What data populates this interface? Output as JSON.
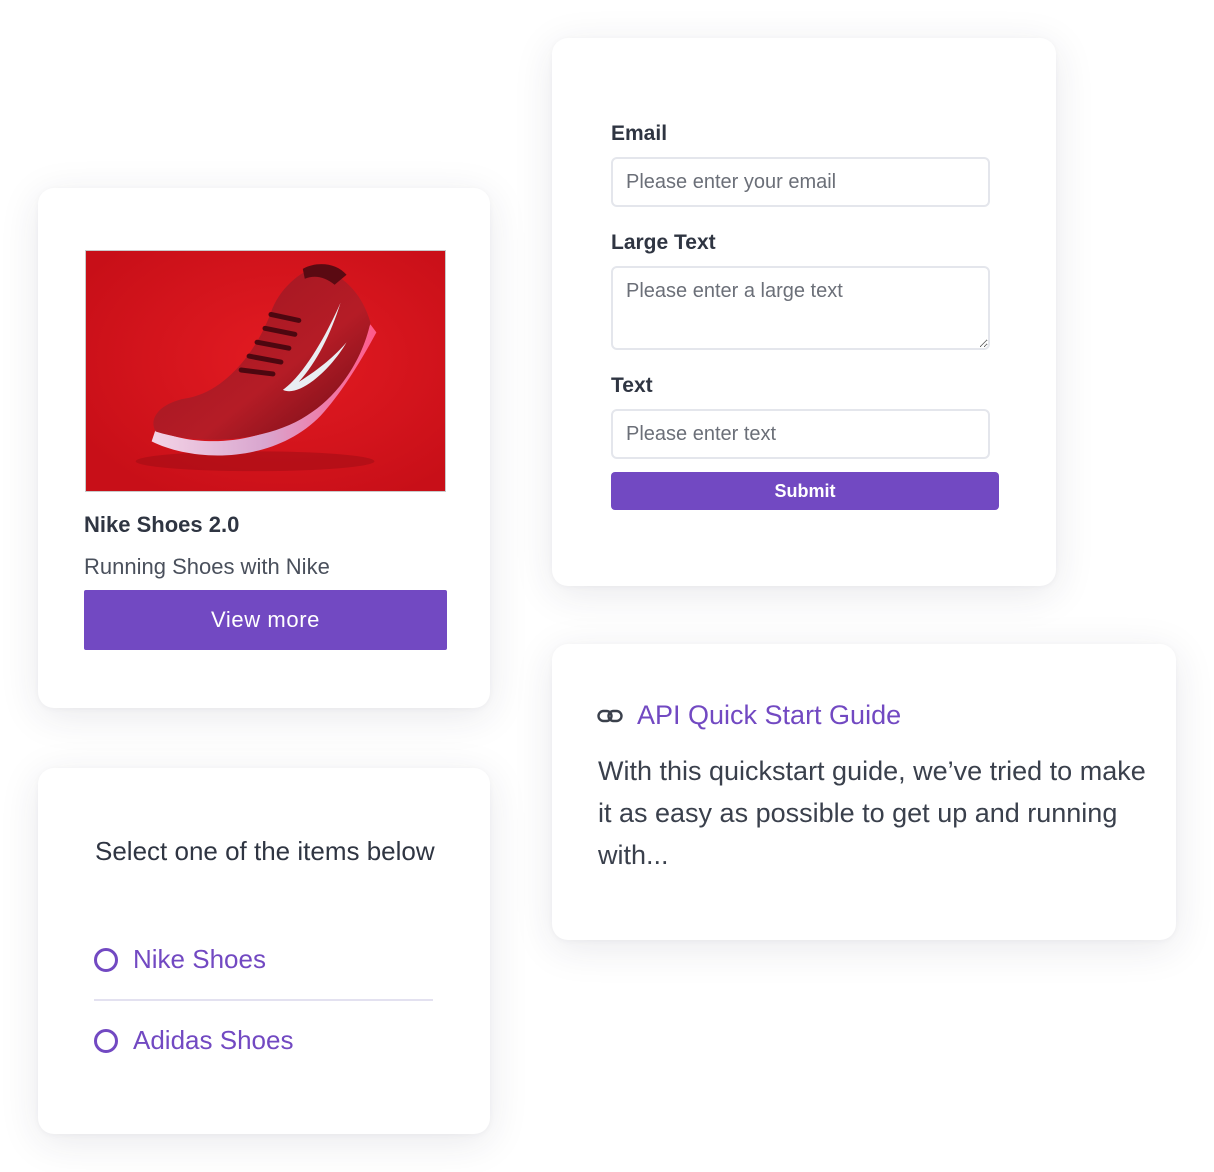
{
  "product_card": {
    "image_alt": "Red Nike running shoe on a red background",
    "title": "Nike Shoes 2.0",
    "subtitle": "Running Shoes with Nike",
    "button_label": "View more"
  },
  "form_card": {
    "email": {
      "label": "Email",
      "placeholder": "Please enter your email",
      "value": ""
    },
    "large_text": {
      "label": "Large Text",
      "placeholder": "Please enter a large text",
      "value": ""
    },
    "text": {
      "label": "Text",
      "placeholder": "Please enter text",
      "value": ""
    },
    "submit_label": "Submit"
  },
  "radio_card": {
    "prompt": "Select one of the items below",
    "options": [
      {
        "label": "Nike Shoes",
        "selected": false
      },
      {
        "label": "Adidas Shoes",
        "selected": false
      }
    ]
  },
  "link_card": {
    "icon": "link-icon",
    "title": "API Quick Start Guide",
    "description": "With this quickstart guide, we’ve tried to make it as easy as possible to get up and running with..."
  },
  "colors": {
    "accent": "#7249c2",
    "text": "#2f3542",
    "muted_text": "#4a505c",
    "field_border": "#e4e6ec",
    "card_background": "#ffffff",
    "product_background": "#d8131b"
  }
}
